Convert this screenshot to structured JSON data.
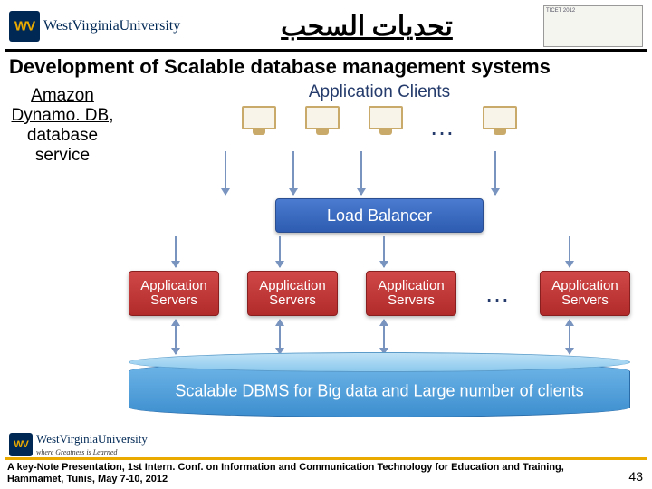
{
  "header": {
    "wvu_name": "WestVirginiaUniversity",
    "title_ar": "تحديات السحب",
    "ticet_text": "TICET 2012"
  },
  "subtitle": "Development of Scalable database management systems",
  "amazon": {
    "line1": "Amazon",
    "line2": "Dynamo. DB,",
    "line3": "database",
    "line4": "service"
  },
  "diagram": {
    "clients_label": "Application Clients",
    "ellipsis": "…",
    "load_balancer": "Load Balancer",
    "app_server": "Application Servers",
    "dbms": "Scalable DBMS for Big data and Large number of clients"
  },
  "footer": {
    "wvu_name": "WestVirginiaUniversity",
    "tagline": "where Greatness is Learned",
    "note_l1": "A key-Note Presentation, 1st Intern. Conf. on Information and Communication Technology for Education and Training,",
    "note_l2": "Hammamet, Tunis, May 7-10, 2012",
    "page": "43"
  }
}
